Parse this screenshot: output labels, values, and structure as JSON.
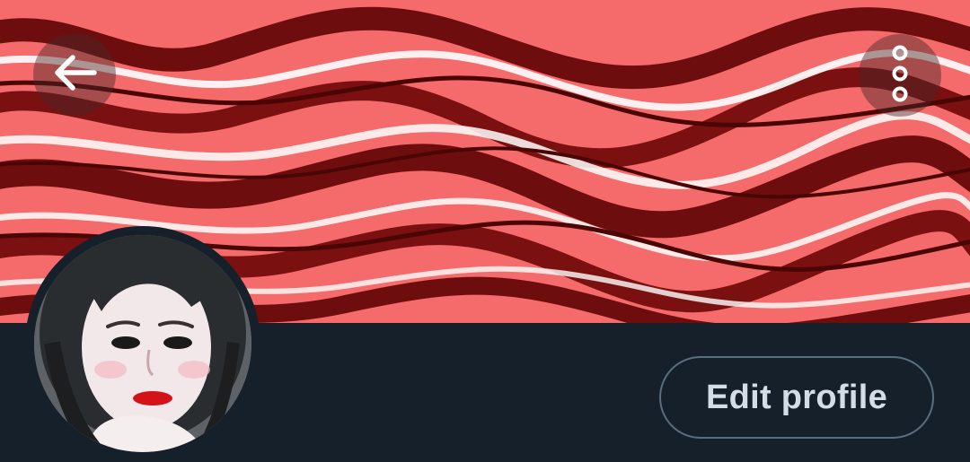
{
  "header": {
    "back_icon": "arrow-left-icon",
    "more_icon": "more-vertical-icon"
  },
  "profile": {
    "edit_label": "Edit profile"
  },
  "colors": {
    "background": "#15202b",
    "banner_base": "#f56a6a",
    "banner_dark": "#6e0d0d",
    "button_border": "#5b6e7d",
    "button_text": "#d4dde6"
  }
}
